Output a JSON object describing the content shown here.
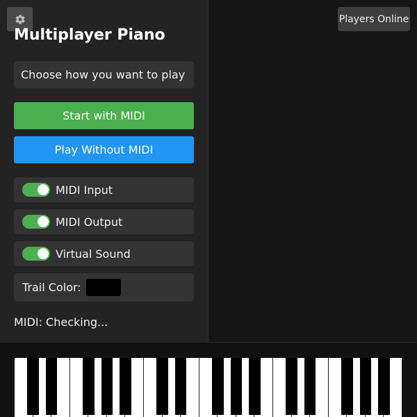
{
  "panel": {
    "title": "Multiplayer Piano",
    "info_text": "Choose how you want to play",
    "buttons": {
      "start_midi": "Start with MIDI",
      "play_without_midi": "Play Without MIDI"
    },
    "toggles": [
      {
        "label": "MIDI Input",
        "on": true
      },
      {
        "label": "MIDI Output",
        "on": true
      },
      {
        "label": "Virtual Sound",
        "on": true
      }
    ],
    "trail_color": {
      "label": "Trail Color:",
      "value": "#000000"
    },
    "status": "MIDI: Checking..."
  },
  "header": {
    "players_online": "Players Online",
    "settings_icon": "gear-icon"
  },
  "keyboard": {
    "white_key_count": 21,
    "colors": {
      "white": "#ffffff",
      "black": "#000000"
    }
  },
  "colors": {
    "accent_green": "#4caf50",
    "accent_blue": "#2196f3",
    "panel_bg": "#232323",
    "row_bg": "#333333"
  }
}
